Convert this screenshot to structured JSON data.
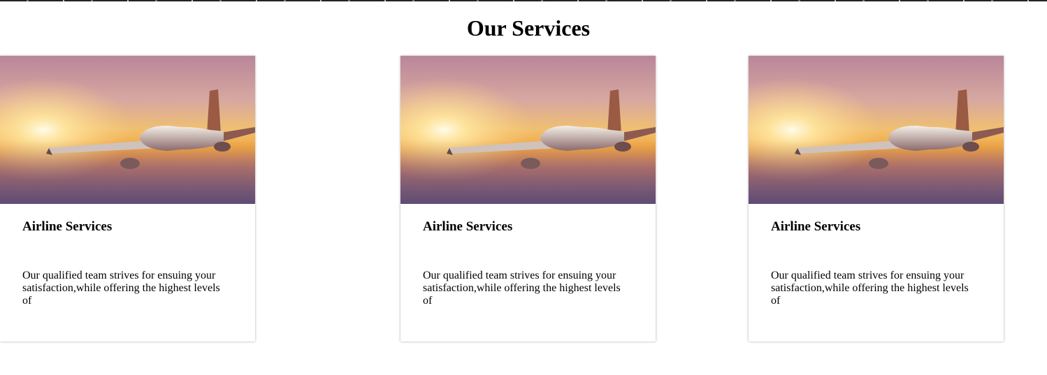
{
  "page": {
    "title": "Our Services"
  },
  "services": [
    {
      "title": "Airline Services",
      "description": "Our qualified team strives for ensuing your satisfaction,while offering the highest levels of",
      "image_icon": "airplane-sunset-photo"
    },
    {
      "title": "Airline Services",
      "description": "Our qualified team strives for ensuing your satisfaction,while offering the highest levels of",
      "image_icon": "airplane-sunset-photo"
    },
    {
      "title": "Airline Services",
      "description": "Our qualified team strives for ensuing your satisfaction,while offering the highest levels of",
      "image_icon": "airplane-sunset-photo"
    }
  ]
}
